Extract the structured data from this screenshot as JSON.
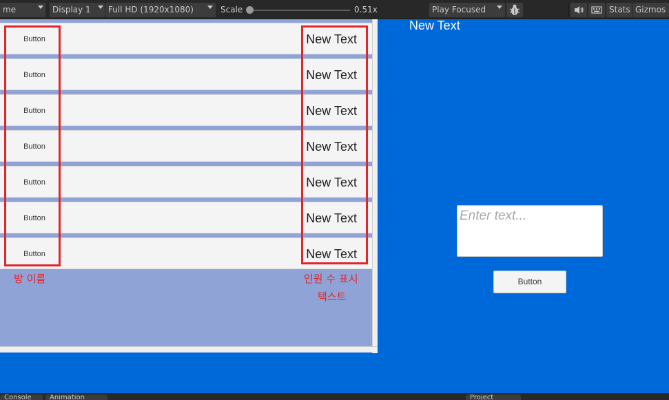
{
  "toolbar": {
    "game_tab_partial": "me",
    "display": "Display 1",
    "resolution": "Full HD (1920x1080)",
    "scale_label": "Scale",
    "scale_value": "0.51x",
    "scale_fraction": 0.0,
    "play_mode": "Play Focused",
    "stats": "Stats",
    "gizmos": "Gizmos"
  },
  "room_list": {
    "rows": [
      {
        "button": "Button",
        "text": "New Text"
      },
      {
        "button": "Button",
        "text": "New Text"
      },
      {
        "button": "Button",
        "text": "New Text"
      },
      {
        "button": "Button",
        "text": "New Text"
      },
      {
        "button": "Button",
        "text": "New Text"
      },
      {
        "button": "Button",
        "text": "New Text"
      },
      {
        "button": "Button",
        "text": "New Text"
      }
    ],
    "annotation_left": "방 이름",
    "annotation_right_line1": "인원 수 표시",
    "annotation_right_line2": "텍스트"
  },
  "game_view": {
    "title": "New Text",
    "input_placeholder": "Enter text...",
    "button_label": "Button"
  },
  "bottom_tabs": {
    "tab1": "Console",
    "tab2": "Animation",
    "tab3": "Project"
  },
  "colors": {
    "game_bg": "#0069d9",
    "panel_bg": "#8fa3d6",
    "highlight": "#e0262c"
  }
}
